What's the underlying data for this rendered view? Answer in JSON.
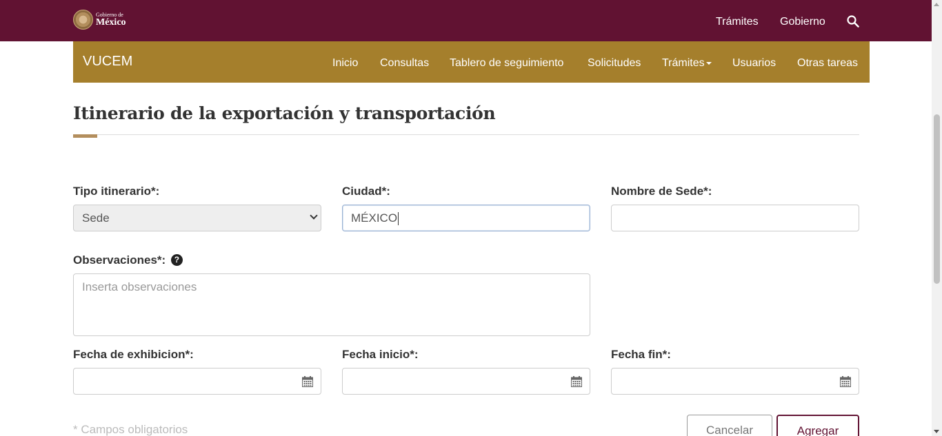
{
  "gov_bar": {
    "logo_small": "Gobierno de",
    "logo_big": "México",
    "links": [
      "Trámites",
      "Gobierno"
    ],
    "search_icon": "search-icon",
    "bg_color": "#611232"
  },
  "main_nav": {
    "brand": "VUCEM",
    "items": [
      "Inicio",
      "Consultas",
      "Tablero de seguimiento",
      "Solicitudes",
      "Trámites",
      "Usuarios",
      "Otras tareas"
    ],
    "dropdown_item": "Trámites",
    "bg_color": "#a57f2c"
  },
  "page": {
    "title": "Itinerario de la exportación y transportación",
    "accent_color": "#b38e5d"
  },
  "form": {
    "tipo_label": "Tipo itinerario*:",
    "tipo_value": "Sede",
    "ciudad_label": "Ciudad*:",
    "ciudad_value": "MÉXICO",
    "sede_label": "Nombre de Sede*:",
    "sede_value": "",
    "obs_label": "Observaciones*:",
    "obs_placeholder": "Inserta observaciones",
    "help_icon": "question-circle-icon",
    "fecha_exhibicion_label": "Fecha de exhibicion*:",
    "fecha_inicio_label": "Fecha inicio*:",
    "fecha_fin_label": "Fecha fin*:",
    "calendar_icon": "calendar-icon",
    "required_note": "* Campos obligatorios",
    "cancel_label": "Cancelar",
    "add_label": "Agregar"
  }
}
